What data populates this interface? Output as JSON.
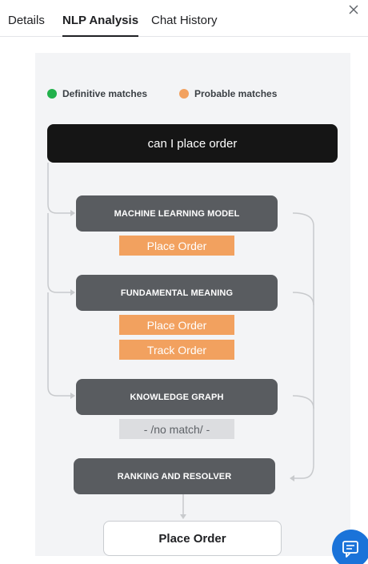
{
  "tabs": [
    {
      "label": "Details"
    },
    {
      "label": "NLP Analysis"
    },
    {
      "label": "Chat History"
    }
  ],
  "active_tab": "NLP Analysis",
  "legend": {
    "definitive": {
      "label": "Definitive matches",
      "color": "#22b14c"
    },
    "probable": {
      "label": "Probable matches",
      "color": "#f2a15f"
    }
  },
  "query": "can I place order",
  "engines": [
    {
      "label": "MACHINE LEARNING MODEL",
      "matches": [
        "Place Order"
      ]
    },
    {
      "label": "FUNDAMENTAL MEANING",
      "matches": [
        "Place Order",
        "Track Order"
      ]
    },
    {
      "label": "KNOWLEDGE GRAPH",
      "no_match": "- /no match/ -"
    }
  ],
  "resolver": {
    "label": "RANKING AND RESOLVER"
  },
  "result": "Place Order",
  "icons": {
    "close": "close-icon",
    "chat": "chat-icon"
  }
}
